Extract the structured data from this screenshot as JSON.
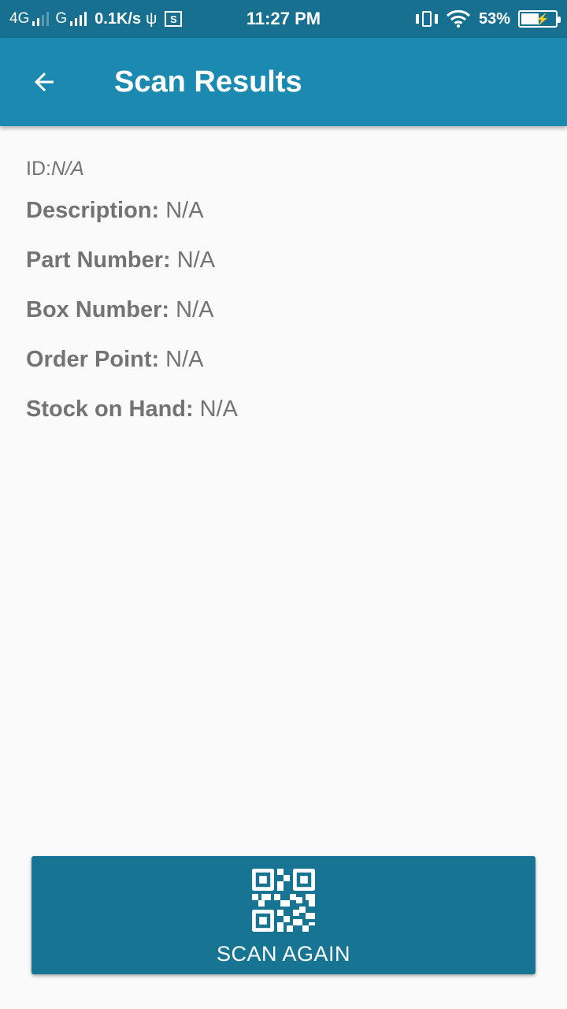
{
  "status_bar": {
    "network_1": "4G",
    "network_2": "G",
    "speed": "0.1K/s",
    "time": "11:27 PM",
    "battery": "53%",
    "battery_level": 0.53
  },
  "app_bar": {
    "title": "Scan Results",
    "back_icon": "arrow-back-icon"
  },
  "details": {
    "id_label": "ID:",
    "id_value": "N/A",
    "rows": [
      {
        "label": "Description:",
        "value": "N/A"
      },
      {
        "label": "Part Number:",
        "value": "N/A"
      },
      {
        "label": "Box Number:",
        "value": "N/A"
      },
      {
        "label": "Order Point:",
        "value": "N/A"
      },
      {
        "label": "Stock on Hand:",
        "value": "N/A"
      }
    ]
  },
  "scan_button": {
    "label": "SCAN AGAIN",
    "icon": "qr-code-icon"
  },
  "colors": {
    "status_bar": "#17708f",
    "app_bar": "#1b89b0",
    "button": "#177493",
    "text": "#737373",
    "background": "#fafafa"
  }
}
